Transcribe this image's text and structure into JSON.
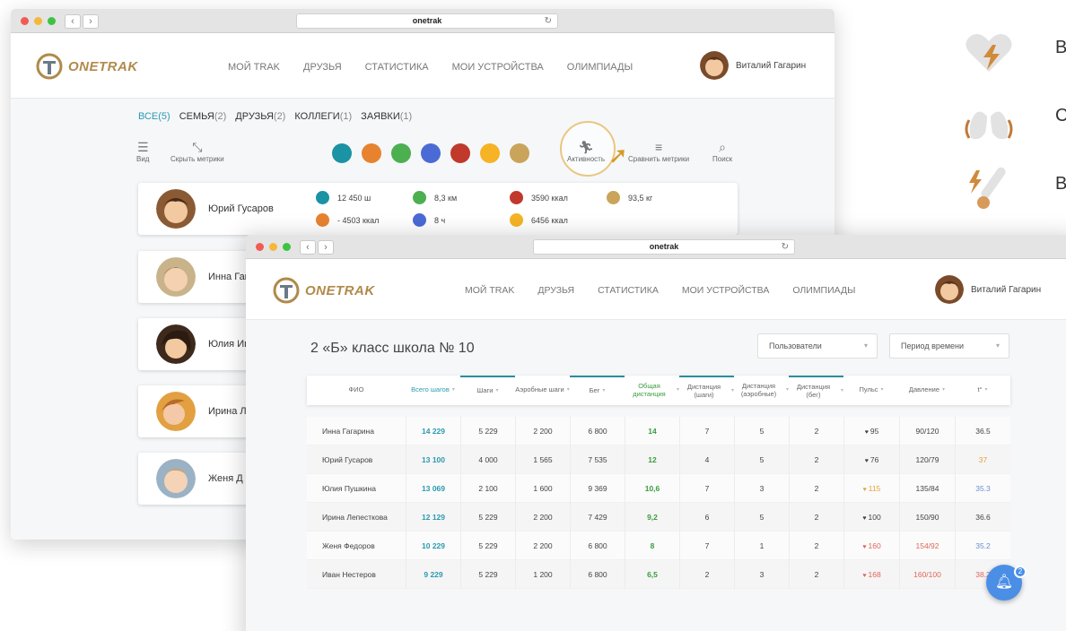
{
  "brand": {
    "name": "ONETRAK",
    "accent": "#b08a4a",
    "teal": "#2a9bb0",
    "green": "#3b9c3e"
  },
  "url": "onetrak",
  "nav": [
    "МОЙ TRAK",
    "ДРУЗЬЯ",
    "СТАТИСТИКА",
    "МОИ УСТРОЙСТВА",
    "ОЛИМПИАДЫ"
  ],
  "user": {
    "name": "Виталий Гагарин"
  },
  "filters": [
    {
      "label": "ВСЕ",
      "count": "(5)"
    },
    {
      "label": "СЕМЬЯ",
      "count": "(2)"
    },
    {
      "label": "ДРУЗЬЯ",
      "count": "(2)"
    },
    {
      "label": "КОЛЛЕГИ",
      "count": "(1)"
    },
    {
      "label": "ЗАЯВКИ",
      "count": "(1)"
    }
  ],
  "tools": {
    "view": "Вид",
    "hide": "Скрыть метрики",
    "activity": "Активность",
    "compare": "Сравнить метрики",
    "search": "Поиск"
  },
  "metric_colors": [
    "#1a93a4",
    "#e7832f",
    "#4caf50",
    "#4a6bd6",
    "#c0392b",
    "#f5b325",
    "#c9a45a"
  ],
  "friends": [
    {
      "name": "Юрий Гусаров",
      "steps": "12 450 ш",
      "balance": "- 4503 ккал",
      "distance": "8,3 км",
      "sleep": "8 ч",
      "food": "3590 ккал",
      "burned": "6456 ккал",
      "weight": "93,5 кг"
    },
    {
      "name": "Инна Гаг"
    },
    {
      "name": "Юлия Ив"
    },
    {
      "name": "Ирина Л"
    },
    {
      "name": "Женя Д"
    }
  ],
  "table": {
    "title": "2  «Б» класс школа № 10",
    "select_users": "Пользователи",
    "select_period": "Период времени",
    "headers": [
      "ФИО",
      "Всего шагов",
      "Шаги",
      "Аэробные шаги",
      "Бег",
      "Общая дистанция",
      "Дистанция (шаги)",
      "Дистанция (аэробные)",
      "Дистанция (бег)",
      "Пульс",
      "Давление",
      "t°"
    ],
    "rows": [
      [
        "Инна Гагарина",
        "14 229",
        "5 229",
        "2 200",
        "6 800",
        "14",
        "7",
        "5",
        "2",
        "95",
        "90/120",
        "36.5"
      ],
      [
        "Юрий Гусаров",
        "13 100",
        "4 000",
        "1 565",
        "7 535",
        "12",
        "4",
        "5",
        "2",
        "76",
        "120/79",
        "37"
      ],
      [
        "Юлия Пушкина",
        "13 069",
        "2 100",
        "1 600",
        "9 369",
        "10,6",
        "7",
        "3",
        "2",
        "115",
        "135/84",
        "35.3"
      ],
      [
        "Ирина Лепесткова",
        "12 129",
        "5 229",
        "2 200",
        "7 429",
        "9,2",
        "6",
        "5",
        "2",
        "100",
        "150/90",
        "36.6"
      ],
      [
        "Женя Федоров",
        "10 229",
        "5 229",
        "2 200",
        "6 800",
        "8",
        "7",
        "1",
        "2",
        "160",
        "154/92",
        "35.2"
      ],
      [
        "Иван Нестеров",
        "9 229",
        "5 229",
        "1 200",
        "6 800",
        "6,5",
        "2",
        "3",
        "2",
        "168",
        "160/100",
        "38.2"
      ]
    ]
  },
  "notifications": {
    "count": "2"
  },
  "features": [
    "В",
    "С",
    "В"
  ]
}
